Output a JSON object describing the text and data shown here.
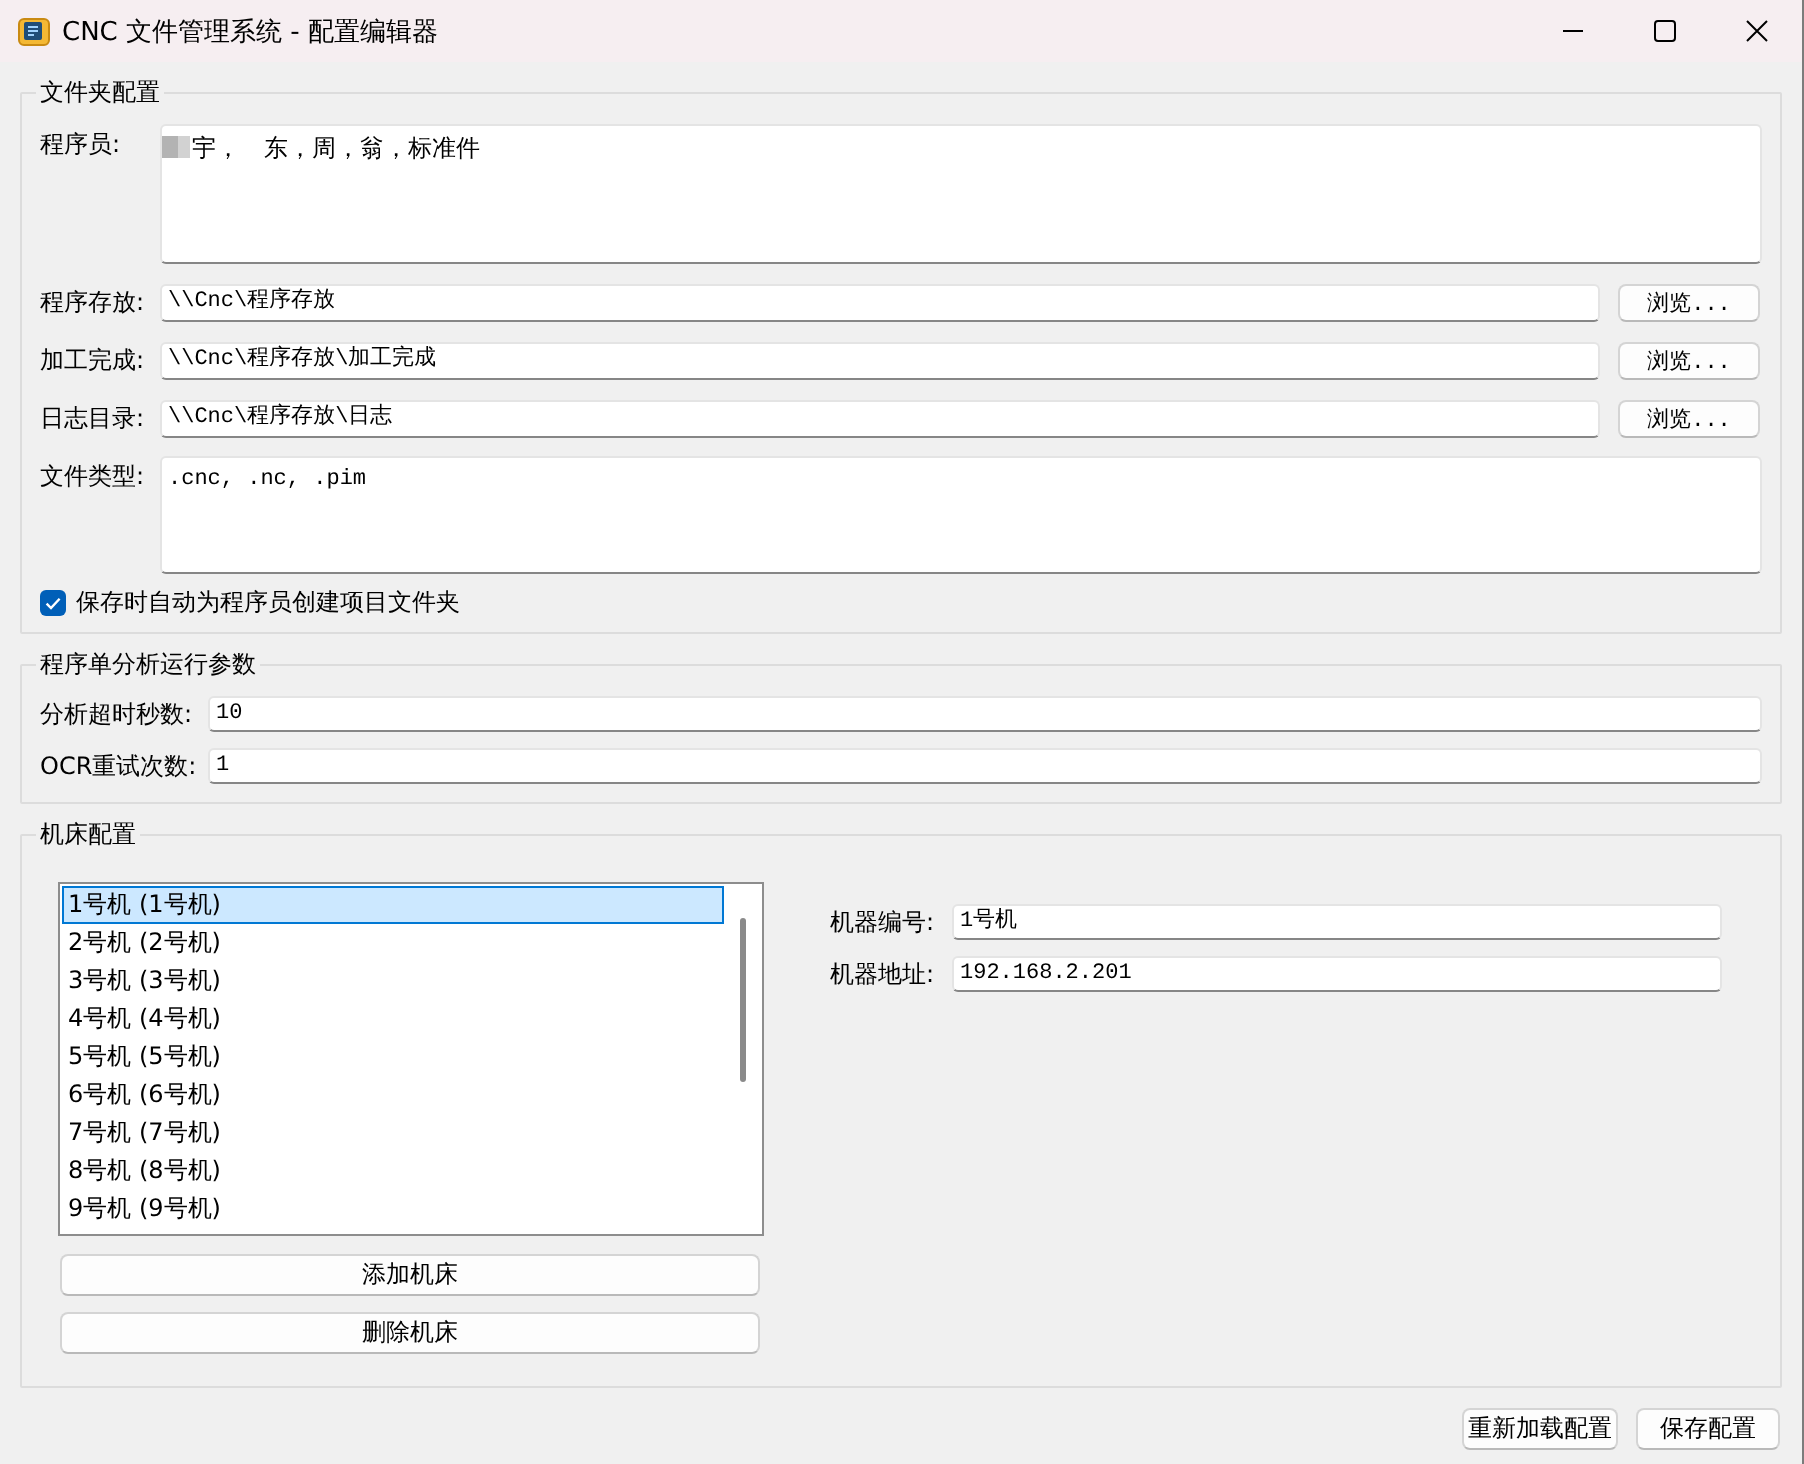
{
  "window": {
    "title": "CNC 文件管理系统 - 配置编辑器"
  },
  "folder_config": {
    "title": "文件夹配置",
    "programmers": {
      "label": "程序员:",
      "value": "宇，　东，周，翁，标准件"
    },
    "paths": [
      {
        "label": "程序存放:",
        "value": "\\\\Cnc\\程序存放",
        "button": "浏览..."
      },
      {
        "label": "加工完成:",
        "value": "\\\\Cnc\\程序存放\\加工完成",
        "button": "浏览..."
      },
      {
        "label": "日志目录:",
        "value": "\\\\Cnc\\程序存放\\日志",
        "button": "浏览..."
      }
    ],
    "file_types": {
      "label": "文件类型:",
      "value": ".cnc, .nc, .pim"
    },
    "auto_create": {
      "label": "保存时自动为程序员创建项目文件夹",
      "checked": true
    }
  },
  "analysis": {
    "title": "程序单分析运行参数",
    "fields": [
      {
        "label": "分析超时秒数:",
        "value": "10"
      },
      {
        "label": "OCR重试次数:",
        "value": "1"
      }
    ]
  },
  "machines": {
    "title": "机床配置",
    "list": [
      {
        "label": "1号机 (1号机)",
        "selected": true
      },
      {
        "label": "2号机 (2号机)",
        "selected": false
      },
      {
        "label": "3号机 (3号机)",
        "selected": false
      },
      {
        "label": "4号机 (4号机)",
        "selected": false
      },
      {
        "label": "5号机 (5号机)",
        "selected": false
      },
      {
        "label": "6号机 (6号机)",
        "selected": false
      },
      {
        "label": "7号机 (7号机)",
        "selected": false
      },
      {
        "label": "8号机 (8号机)",
        "selected": false
      },
      {
        "label": "9号机 (9号机)",
        "selected": false
      }
    ],
    "buttons": [
      "添加机床",
      "删除机床"
    ],
    "fields": [
      {
        "label": "机器编号:",
        "value": "1号机"
      },
      {
        "label": "机器地址:",
        "value": "192.168.2.201"
      }
    ]
  },
  "footer": {
    "buttons": [
      "重新加载配置",
      "保存配置"
    ]
  }
}
